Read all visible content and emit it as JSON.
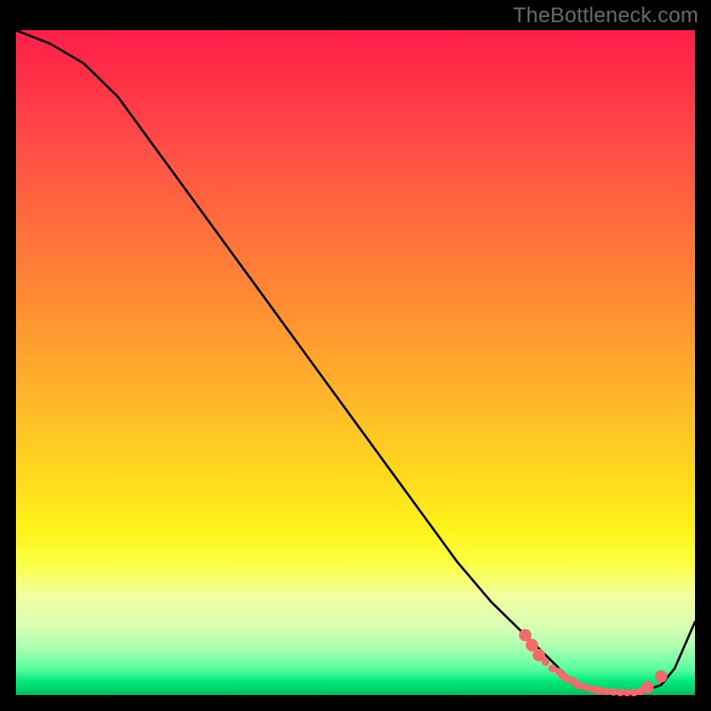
{
  "watermark": "TheBottleneck.com",
  "chart_data": {
    "type": "line",
    "title": "",
    "xlabel": "",
    "ylabel": "",
    "xlim": [
      0,
      100
    ],
    "ylim": [
      0,
      100
    ],
    "grid": false,
    "series": [
      {
        "name": "bottleneck-curve",
        "color": "#000000",
        "x": [
          0,
          5,
          10,
          15,
          20,
          25,
          30,
          35,
          40,
          45,
          50,
          55,
          60,
          65,
          70,
          75,
          80,
          82,
          85,
          88,
          90,
          92,
          95,
          97,
          100
        ],
        "y": [
          100,
          98,
          95,
          90,
          83,
          76,
          69,
          62,
          55,
          48,
          41,
          34,
          27,
          20,
          14,
          9,
          4,
          2,
          0.8,
          0.4,
          0.3,
          0.5,
          1.5,
          4,
          11
        ]
      }
    ],
    "highlight_points": {
      "name": "optimal-range",
      "color": "#f26b6b",
      "radius_large_at": [
        75,
        76,
        77,
        93,
        95
      ],
      "x": [
        75,
        76,
        77,
        78,
        79,
        80,
        80.5,
        81,
        82,
        82.5,
        83,
        84,
        85,
        85.5,
        86,
        87,
        88,
        89,
        90,
        91,
        92,
        93,
        95
      ],
      "y": [
        9,
        7.5,
        6,
        5,
        4,
        3.5,
        3,
        2.6,
        2.2,
        1.8,
        1.5,
        1.2,
        0.9,
        0.8,
        0.7,
        0.6,
        0.5,
        0.4,
        0.4,
        0.4,
        0.6,
        1.2,
        2.8
      ]
    }
  }
}
